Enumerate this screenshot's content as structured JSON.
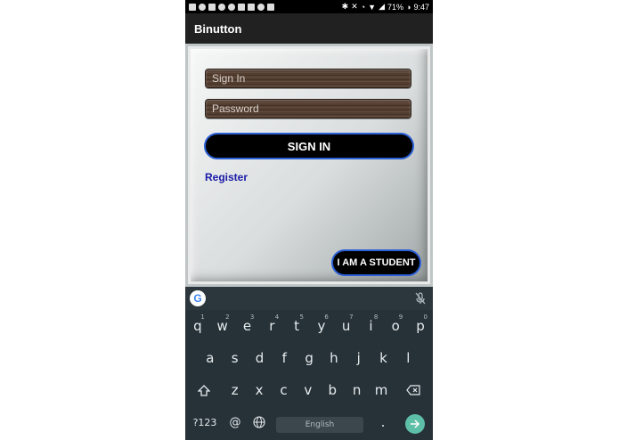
{
  "status_bar": {
    "battery": "71%",
    "time": "9:47"
  },
  "app": {
    "title": "Binutton"
  },
  "form": {
    "signin_placeholder": "Sign In",
    "password_placeholder": "Password",
    "signin_button": "SIGN IN",
    "register_link": "Register",
    "student_button": "I AM A STUDENT"
  },
  "keyboard": {
    "google_logo": "G",
    "row1": [
      {
        "key": "q",
        "hint": "1"
      },
      {
        "key": "w",
        "hint": "2"
      },
      {
        "key": "e",
        "hint": "3"
      },
      {
        "key": "r",
        "hint": "4"
      },
      {
        "key": "t",
        "hint": "5"
      },
      {
        "key": "y",
        "hint": "6"
      },
      {
        "key": "u",
        "hint": "7"
      },
      {
        "key": "i",
        "hint": "8"
      },
      {
        "key": "o",
        "hint": "9"
      },
      {
        "key": "p",
        "hint": "0"
      }
    ],
    "row2": [
      "a",
      "s",
      "d",
      "f",
      "g",
      "h",
      "j",
      "k",
      "l"
    ],
    "row3": [
      "z",
      "x",
      "c",
      "v",
      "b",
      "n",
      "m"
    ],
    "symbols_key": "?123",
    "at_key": "@",
    "space_label": "English",
    "period_key": "."
  }
}
